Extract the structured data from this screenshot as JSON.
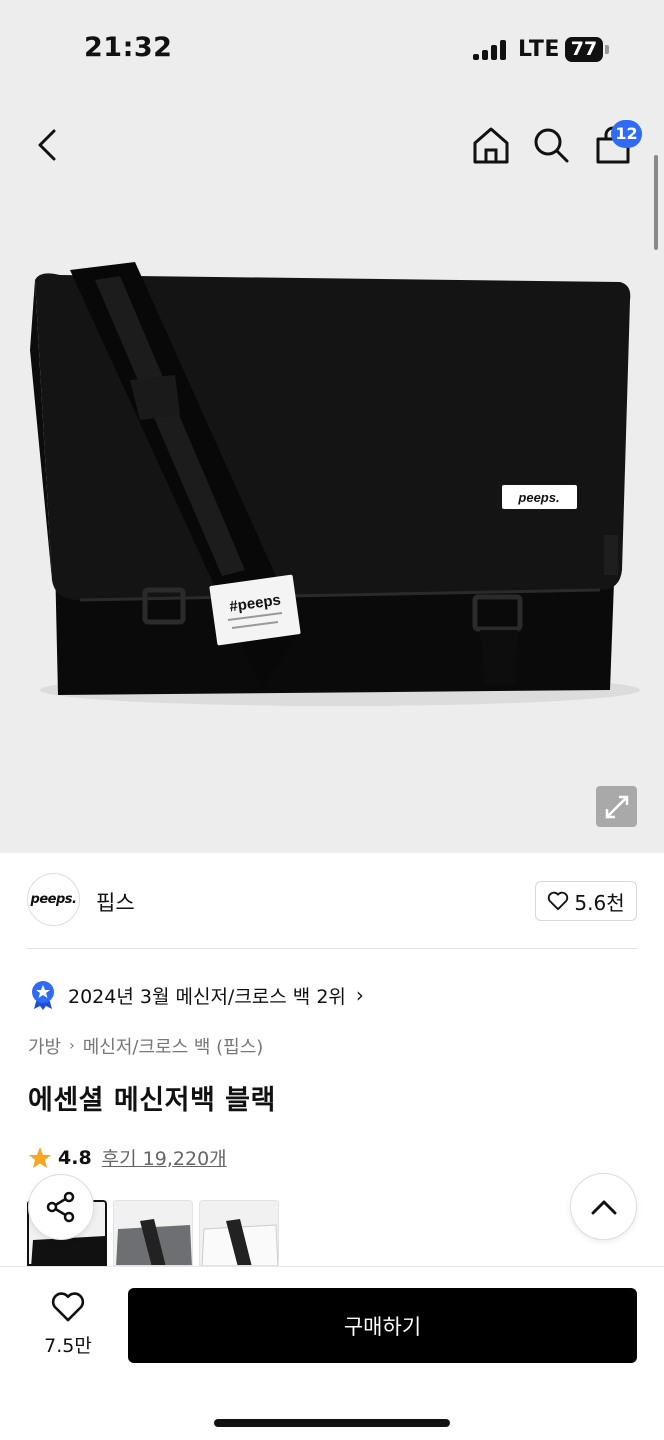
{
  "status_bar": {
    "time": "21:32",
    "network": "LTE",
    "battery": "77"
  },
  "header": {
    "icons": [
      "back-arrow-icon",
      "home-icon",
      "search-icon",
      "shopping-bag-icon"
    ],
    "cart_count": "12"
  },
  "product_image": {
    "label_flap": "peeps.",
    "label_strap": "#peeps",
    "bag_color": "#0d0d0d",
    "background": "#ededed"
  },
  "brand": {
    "logo_text": "peeps.",
    "name": "핍스",
    "likes": "5.6천"
  },
  "ranking": {
    "text": "2024년 3월 메신저/크로스 백 2위",
    "chevron": "›"
  },
  "breadcrumb": {
    "items": [
      "가방",
      "메신저/크로스 백 (핍스)"
    ],
    "separator": "›"
  },
  "product": {
    "title": "에센셜 메신저백 블랙",
    "rating": "4.8",
    "reviews": "후기 19,220개"
  },
  "variants": {
    "colors": [
      "#111111",
      "#6d6f73",
      "#f5f5f5"
    ],
    "selected_index": 0
  },
  "bottom_bar": {
    "wish_count": "7.5만",
    "buy_label": "구매하기"
  },
  "colors": {
    "accent_blue": "#2f6bf5",
    "star": "#f5a623",
    "buy_button": "#000000"
  }
}
